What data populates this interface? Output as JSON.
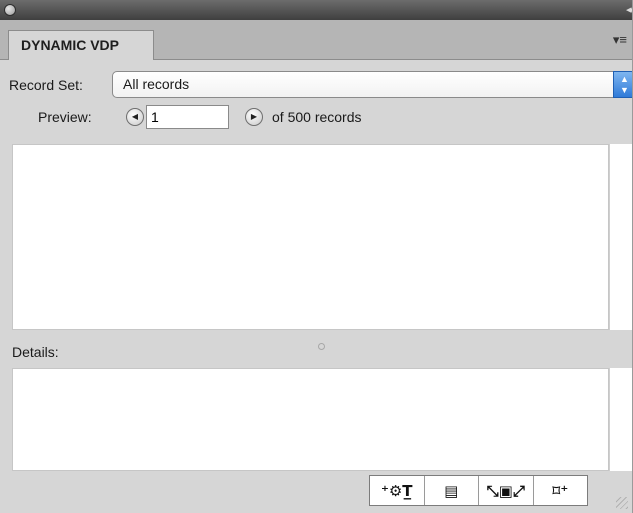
{
  "panel": {
    "tab_label": "DYNAMIC VDP",
    "collapse_glyph": "◂◂",
    "menu_glyph": "▾≡"
  },
  "record_set": {
    "label": "Record Set:",
    "selected": "All records",
    "arrows": "▲▼"
  },
  "preview": {
    "label": "Preview:",
    "current_record": "1",
    "total_text": "of 500 records",
    "prev_glyph": "◀",
    "next_glyph": "▶"
  },
  "details": {
    "label": "Details:"
  },
  "toolbar": {
    "buttons": [
      {
        "name": "insert-field-icon",
        "glyph": "⁺⚙T̲"
      },
      {
        "name": "record-card-icon",
        "glyph": "▤"
      },
      {
        "name": "fit-frame-icon",
        "glyph": "⤡▣⤢"
      },
      {
        "name": "new-frame-icon",
        "glyph": "⌑⁺"
      }
    ]
  }
}
